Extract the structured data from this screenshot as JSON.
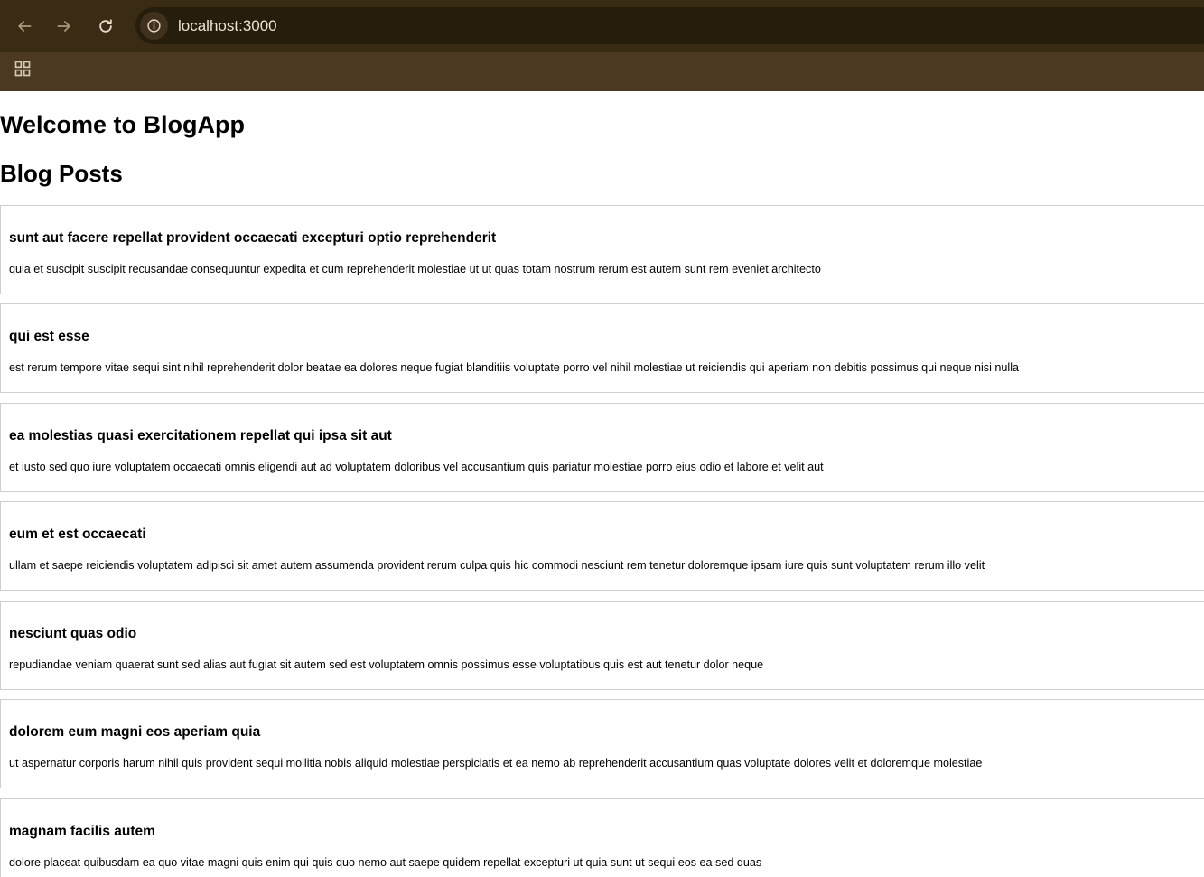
{
  "browser": {
    "url": "localhost:3000",
    "icons": {
      "back": "arrow-left-icon",
      "forward": "arrow-right-icon",
      "reload": "reload-icon",
      "site_info": "info-icon",
      "apps": "apps-grid-icon"
    }
  },
  "page": {
    "heading": "Welcome to BlogApp",
    "subheading": "Blog Posts",
    "posts": [
      {
        "title": "sunt aut facere repellat provident occaecati excepturi optio reprehenderit",
        "body": "quia et suscipit suscipit recusandae consequuntur expedita et cum reprehenderit molestiae ut ut quas totam nostrum rerum est autem sunt rem eveniet architecto"
      },
      {
        "title": "qui est esse",
        "body": "est rerum tempore vitae sequi sint nihil reprehenderit dolor beatae ea dolores neque fugiat blanditiis voluptate porro vel nihil molestiae ut reiciendis qui aperiam non debitis possimus qui neque nisi nulla"
      },
      {
        "title": "ea molestias quasi exercitationem repellat qui ipsa sit aut",
        "body": "et iusto sed quo iure voluptatem occaecati omnis eligendi aut ad voluptatem doloribus vel accusantium quis pariatur molestiae porro eius odio et labore et velit aut"
      },
      {
        "title": "eum et est occaecati",
        "body": "ullam et saepe reiciendis voluptatem adipisci sit amet autem assumenda provident rerum culpa quis hic commodi nesciunt rem tenetur doloremque ipsam iure quis sunt voluptatem rerum illo velit"
      },
      {
        "title": "nesciunt quas odio",
        "body": "repudiandae veniam quaerat sunt sed alias aut fugiat sit autem sed est voluptatem omnis possimus esse voluptatibus quis est aut tenetur dolor neque"
      },
      {
        "title": "dolorem eum magni eos aperiam quia",
        "body": "ut aspernatur corporis harum nihil quis provident sequi mollitia nobis aliquid molestiae perspiciatis et ea nemo ab reprehenderit accusantium quas voluptate dolores velit et doloremque molestiae"
      },
      {
        "title": "magnam facilis autem",
        "body": "dolore placeat quibusdam ea quo vitae magni quis enim qui quis quo nemo aut saepe quidem repellat excepturi ut quia sunt ut sequi eos ea sed quas"
      }
    ]
  }
}
